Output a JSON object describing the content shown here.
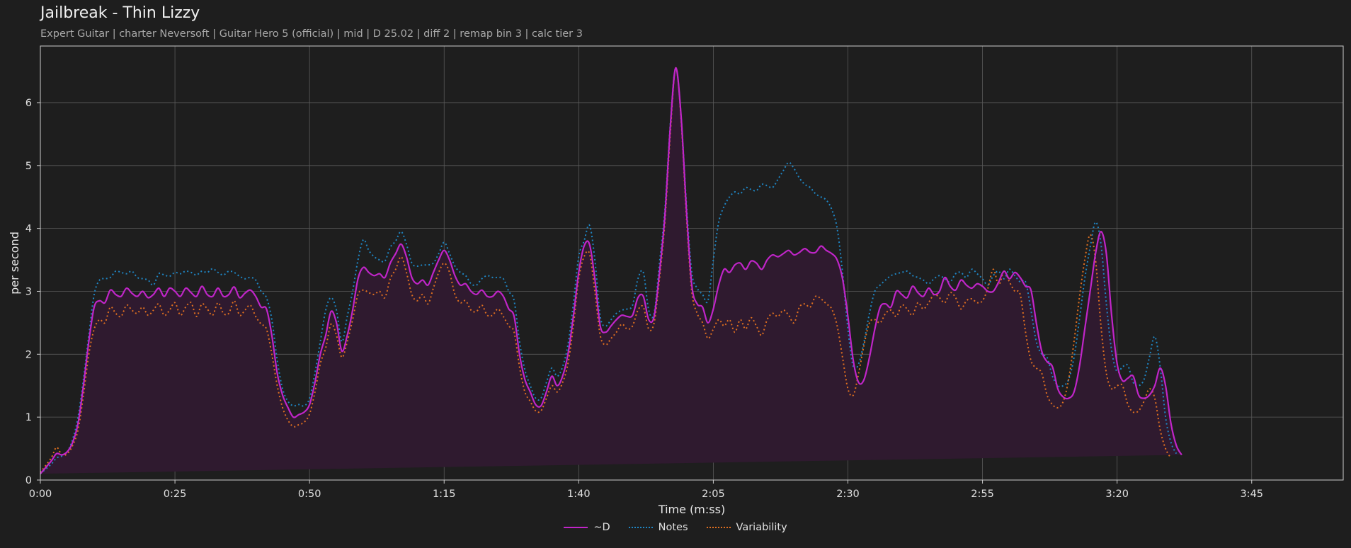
{
  "header": {
    "title": "Jailbreak - Thin Lizzy",
    "subtitle": "Expert Guitar  |  charter Neversoft  |  Guitar Hero 5 (official)  |  mid  |  D 25.02  |  diff 2  |  remap bin 3  |  calc tier 3"
  },
  "legend": {
    "d_label": "~D",
    "notes_label": "Notes",
    "var_label": "Variability"
  },
  "colors": {
    "background": "#1e1e1e",
    "d": "#c025c8",
    "notes": "#1f86c4",
    "variability": "#e07020",
    "fill": "#2f1a2f",
    "grid": "#5a5a5a",
    "axis": "#cccccc"
  },
  "chart_data": {
    "type": "line",
    "title": "Jailbreak - Thin Lizzy",
    "xlabel": "Time (m:ss)",
    "ylabel": "per second",
    "xlim": [
      0,
      242
    ],
    "ylim": [
      0,
      6.9
    ],
    "xticks": [
      {
        "value": 0,
        "label": "0:00"
      },
      {
        "value": 25,
        "label": "0:25"
      },
      {
        "value": 50,
        "label": "0:50"
      },
      {
        "value": 75,
        "label": "1:15"
      },
      {
        "value": 100,
        "label": "1:40"
      },
      {
        "value": 125,
        "label": "2:05"
      },
      {
        "value": 150,
        "label": "2:30"
      },
      {
        "value": 175,
        "label": "2:55"
      },
      {
        "value": 200,
        "label": "3:20"
      },
      {
        "value": 225,
        "label": "3:45"
      }
    ],
    "yticks": [
      0,
      1,
      2,
      3,
      4,
      5,
      6
    ],
    "grid": true,
    "legend_position": "bottom-center",
    "x": [
      0,
      2,
      3,
      4,
      5,
      6,
      7,
      8,
      9,
      10,
      11,
      12,
      13,
      14,
      15,
      16,
      17,
      18,
      19,
      20,
      21,
      22,
      23,
      24,
      25,
      26,
      27,
      28,
      29,
      30,
      31,
      32,
      33,
      34,
      35,
      36,
      37,
      38,
      39,
      40,
      41,
      42,
      43,
      44,
      45,
      46,
      47,
      48,
      49,
      50,
      51,
      52,
      53,
      54,
      55,
      56,
      57,
      58,
      59,
      60,
      61,
      62,
      63,
      64,
      65,
      66,
      67,
      68,
      69,
      70,
      71,
      72,
      73,
      74,
      75,
      76,
      77,
      78,
      79,
      80,
      81,
      82,
      83,
      84,
      85,
      86,
      87,
      88,
      89,
      90,
      91,
      92,
      93,
      94,
      95,
      96,
      97,
      98,
      99,
      100,
      101,
      102,
      103,
      104,
      105,
      106,
      107,
      108,
      109,
      110,
      111,
      112,
      113,
      114,
      115,
      116,
      117,
      118,
      119,
      120,
      121,
      122,
      123,
      124,
      125,
      126,
      127,
      128,
      129,
      130,
      131,
      132,
      133,
      134,
      135,
      136,
      137,
      138,
      139,
      140,
      141,
      142,
      143,
      144,
      145,
      146,
      147,
      148,
      149,
      150,
      151,
      152,
      153,
      154,
      155,
      156,
      157,
      158,
      159,
      160,
      161,
      162,
      163,
      164,
      165,
      166,
      167,
      168,
      169,
      170,
      171,
      172,
      173,
      174,
      175,
      176,
      177,
      178,
      179,
      180,
      181,
      182,
      183,
      184,
      185,
      186,
      187,
      188,
      189,
      190,
      191,
      192,
      193,
      194,
      195,
      196,
      197,
      198,
      199,
      200,
      201,
      202,
      203,
      204,
      205,
      206,
      207,
      208,
      209,
      210,
      211,
      212,
      213,
      214,
      215,
      216,
      217,
      218,
      219,
      220,
      221,
      222,
      223,
      224,
      225,
      226,
      227,
      228,
      229,
      230,
      231,
      232,
      233,
      234,
      235,
      236,
      237,
      238,
      239,
      240,
      241,
      242
    ],
    "series": [
      {
        "name": "~D",
        "style": "solid",
        "values": [
          0.1,
          0.3,
          0.42,
          0.4,
          0.45,
          0.6,
          0.9,
          1.5,
          2.2,
          2.75,
          2.85,
          2.82,
          3.02,
          2.95,
          2.92,
          3.05,
          2.97,
          2.92,
          3.0,
          2.9,
          2.95,
          3.05,
          2.92,
          3.05,
          3.0,
          2.92,
          3.05,
          2.98,
          2.92,
          3.08,
          2.95,
          2.92,
          3.05,
          2.92,
          2.95,
          3.07,
          2.9,
          2.97,
          3.02,
          2.92,
          2.75,
          2.72,
          2.3,
          1.7,
          1.35,
          1.15,
          1.0,
          1.04,
          1.08,
          1.2,
          1.55,
          2.0,
          2.3,
          2.68,
          2.5,
          2.05,
          2.3,
          2.7,
          3.2,
          3.38,
          3.3,
          3.25,
          3.28,
          3.22,
          3.45,
          3.6,
          3.75,
          3.55,
          3.22,
          3.12,
          3.18,
          3.1,
          3.3,
          3.5,
          3.65,
          3.5,
          3.25,
          3.1,
          3.12,
          3.0,
          2.95,
          3.02,
          2.92,
          2.92,
          3.0,
          2.92,
          2.72,
          2.6,
          2.0,
          1.6,
          1.4,
          1.2,
          1.18,
          1.4,
          1.65,
          1.5,
          1.65,
          2.0,
          2.6,
          3.3,
          3.72,
          3.75,
          3.2,
          2.45,
          2.35,
          2.45,
          2.55,
          2.62,
          2.6,
          2.62,
          2.9,
          2.92,
          2.55,
          2.6,
          3.3,
          4.2,
          5.6,
          6.55,
          5.8,
          4.3,
          3.1,
          2.8,
          2.75,
          2.5,
          2.72,
          3.1,
          3.35,
          3.3,
          3.42,
          3.45,
          3.35,
          3.48,
          3.45,
          3.35,
          3.5,
          3.58,
          3.55,
          3.6,
          3.65,
          3.58,
          3.62,
          3.68,
          3.62,
          3.62,
          3.72,
          3.65,
          3.6,
          3.5,
          3.2,
          2.6,
          1.9,
          1.55,
          1.6,
          1.95,
          2.4,
          2.75,
          2.8,
          2.75,
          3.0,
          2.95,
          2.9,
          3.08,
          2.98,
          2.92,
          3.05,
          2.95,
          3.0,
          3.22,
          3.08,
          3.02,
          3.18,
          3.1,
          3.05,
          3.12,
          3.08,
          3.0,
          3.0,
          3.15,
          3.32,
          3.2,
          3.3,
          3.22,
          3.08,
          3.02,
          2.5,
          2.05,
          1.88,
          1.8,
          1.45,
          1.32,
          1.3,
          1.4,
          1.8,
          2.4,
          3.0,
          3.6,
          3.95,
          3.6,
          2.6,
          1.85,
          1.58,
          1.62,
          1.65,
          1.35,
          1.3,
          1.35,
          1.5,
          1.78,
          1.5,
          0.9,
          0.55,
          0.4,
          0.28
        ]
      },
      {
        "name": "Notes",
        "style": "dotted",
        "values": [
          0.1,
          0.25,
          0.35,
          0.38,
          0.45,
          0.65,
          1.0,
          1.6,
          2.3,
          2.95,
          3.18,
          3.2,
          3.22,
          3.32,
          3.3,
          3.28,
          3.32,
          3.22,
          3.2,
          3.18,
          3.1,
          3.28,
          3.26,
          3.24,
          3.3,
          3.28,
          3.32,
          3.3,
          3.26,
          3.32,
          3.3,
          3.36,
          3.3,
          3.26,
          3.32,
          3.3,
          3.24,
          3.2,
          3.22,
          3.18,
          3.0,
          2.9,
          2.55,
          1.9,
          1.45,
          1.25,
          1.18,
          1.2,
          1.18,
          1.3,
          1.7,
          2.2,
          2.7,
          2.9,
          2.7,
          2.2,
          2.6,
          3.0,
          3.5,
          3.82,
          3.65,
          3.55,
          3.5,
          3.48,
          3.7,
          3.8,
          3.95,
          3.75,
          3.45,
          3.4,
          3.42,
          3.42,
          3.45,
          3.6,
          3.78,
          3.6,
          3.4,
          3.3,
          3.25,
          3.12,
          3.1,
          3.2,
          3.25,
          3.22,
          3.22,
          3.2,
          3.0,
          2.85,
          2.2,
          1.75,
          1.5,
          1.3,
          1.3,
          1.55,
          1.78,
          1.65,
          1.8,
          2.15,
          2.8,
          3.55,
          3.8,
          4.05,
          3.5,
          2.6,
          2.45,
          2.55,
          2.65,
          2.7,
          2.72,
          2.78,
          3.2,
          3.3,
          2.7,
          2.65,
          3.45,
          4.3,
          5.65,
          6.55,
          5.8,
          4.4,
          3.3,
          3.05,
          2.95,
          2.85,
          3.5,
          4.1,
          4.35,
          4.5,
          4.58,
          4.55,
          4.65,
          4.62,
          4.6,
          4.7,
          4.68,
          4.65,
          4.78,
          4.92,
          5.05,
          4.95,
          4.8,
          4.7,
          4.65,
          4.55,
          4.5,
          4.45,
          4.3,
          4.0,
          3.3,
          2.4,
          1.8,
          1.85,
          2.2,
          2.65,
          3.0,
          3.1,
          3.18,
          3.25,
          3.28,
          3.3,
          3.32,
          3.25,
          3.22,
          3.18,
          3.12,
          3.2,
          3.25,
          3.2,
          3.15,
          3.28,
          3.3,
          3.22,
          3.35,
          3.28,
          3.2,
          3.1,
          3.25,
          3.32,
          3.2,
          3.35,
          3.25,
          3.15,
          3.15,
          2.7,
          2.2,
          2.0,
          1.95,
          1.65,
          1.5,
          1.5,
          1.6,
          1.95,
          2.55,
          3.2,
          3.7,
          4.1,
          3.75,
          2.8,
          2.05,
          1.72,
          1.8,
          1.82,
          1.55,
          1.5,
          1.6,
          1.95,
          2.28,
          1.8,
          1.0,
          0.6,
          0.42,
          0.3
        ]
      },
      {
        "name": "Variability",
        "style": "dotted",
        "values": [
          0.12,
          0.35,
          0.52,
          0.4,
          0.42,
          0.55,
          0.8,
          1.35,
          2.0,
          2.4,
          2.55,
          2.5,
          2.75,
          2.65,
          2.6,
          2.78,
          2.7,
          2.65,
          2.75,
          2.62,
          2.7,
          2.8,
          2.62,
          2.7,
          2.82,
          2.62,
          2.75,
          2.82,
          2.6,
          2.8,
          2.72,
          2.62,
          2.82,
          2.65,
          2.65,
          2.85,
          2.62,
          2.7,
          2.78,
          2.6,
          2.48,
          2.4,
          2.0,
          1.5,
          1.15,
          0.95,
          0.85,
          0.88,
          0.92,
          1.05,
          1.4,
          1.85,
          2.1,
          2.48,
          2.3,
          1.95,
          2.2,
          2.55,
          2.95,
          3.02,
          2.98,
          2.95,
          3.0,
          2.9,
          3.2,
          3.35,
          3.55,
          3.3,
          2.95,
          2.85,
          2.95,
          2.8,
          3.05,
          3.3,
          3.45,
          3.3,
          2.95,
          2.82,
          2.85,
          2.7,
          2.68,
          2.78,
          2.62,
          2.62,
          2.72,
          2.6,
          2.45,
          2.35,
          1.8,
          1.4,
          1.25,
          1.1,
          1.1,
          1.3,
          1.5,
          1.4,
          1.55,
          1.85,
          2.45,
          3.2,
          3.55,
          3.6,
          3.0,
          2.3,
          2.15,
          2.25,
          2.35,
          2.48,
          2.4,
          2.45,
          2.7,
          2.75,
          2.4,
          2.5,
          3.2,
          4.1,
          5.5,
          6.55,
          5.75,
          4.2,
          3.0,
          2.65,
          2.5,
          2.25,
          2.4,
          2.55,
          2.45,
          2.55,
          2.35,
          2.55,
          2.4,
          2.58,
          2.45,
          2.3,
          2.55,
          2.65,
          2.6,
          2.7,
          2.62,
          2.5,
          2.75,
          2.8,
          2.75,
          2.92,
          2.88,
          2.8,
          2.72,
          2.45,
          1.95,
          1.45,
          1.35,
          1.7,
          2.15,
          2.5,
          2.55,
          2.5,
          2.65,
          2.7,
          2.6,
          2.78,
          2.72,
          2.62,
          2.82,
          2.72,
          2.82,
          2.95,
          2.9,
          2.82,
          2.98,
          2.9,
          2.72,
          2.85,
          2.88,
          2.82,
          2.85,
          3.05,
          3.35,
          3.1,
          3.32,
          3.15,
          3.0,
          2.95,
          2.35,
          1.9,
          1.78,
          1.7,
          1.35,
          1.2,
          1.15,
          1.25,
          1.6,
          2.2,
          2.9,
          3.5,
          3.9,
          3.5,
          2.45,
          1.7,
          1.45,
          1.5,
          1.5,
          1.2,
          1.08,
          1.1,
          1.25,
          1.45,
          1.3,
          0.8,
          0.5,
          0.35,
          0.25
        ]
      }
    ]
  }
}
